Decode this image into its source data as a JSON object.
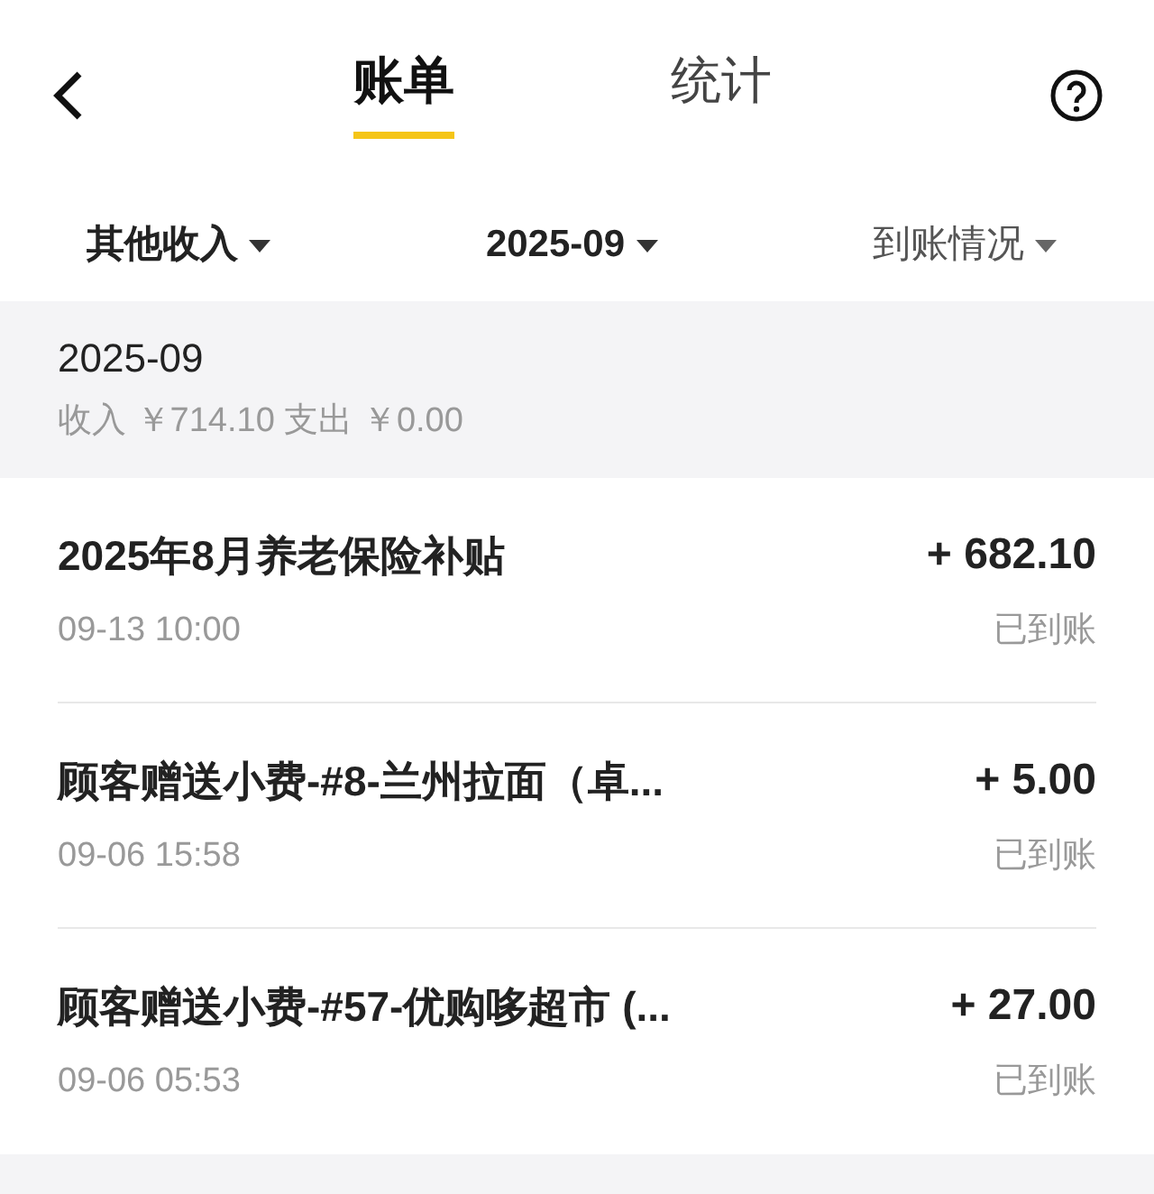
{
  "tabs": [
    {
      "label": "账单",
      "selected": true
    },
    {
      "label": "统计",
      "selected": false
    }
  ],
  "filters": [
    {
      "label": "其他收入",
      "active": true
    },
    {
      "label": "2025-09",
      "active": true
    },
    {
      "label": "到账情况",
      "active": false
    }
  ],
  "summary": {
    "month": "2025-09",
    "totals": "收入 ￥714.10 支出 ￥0.00"
  },
  "transactions": [
    {
      "title": "2025年8月养老保险补贴",
      "time": "09-13 10:00",
      "amount": "+ 682.10",
      "status": "已到账"
    },
    {
      "title": "顾客赠送小费-#8-兰州拉面（卓...",
      "time": "09-06 15:58",
      "amount": "+ 5.00",
      "status": "已到账"
    },
    {
      "title": "顾客赠送小费-#57-优购哆超市 (...",
      "time": "09-06 05:53",
      "amount": "+ 27.00",
      "status": "已到账"
    }
  ]
}
